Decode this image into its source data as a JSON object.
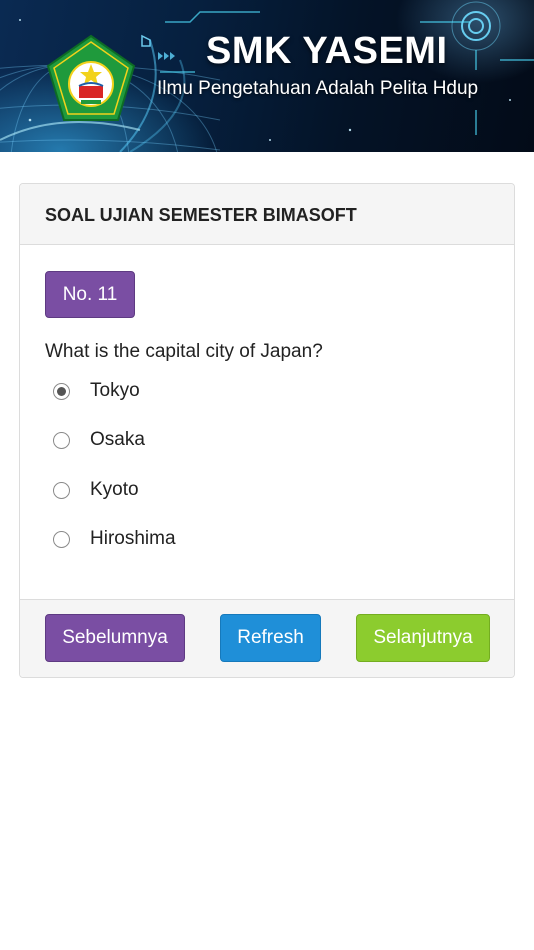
{
  "header": {
    "school_name": "SMK YASEMI",
    "motto": "Ilmu Pengetahuan Adalah Pelita Hdup"
  },
  "panel": {
    "title": "SOAL UJIAN SEMESTER BIMASOFT",
    "question_number": "No. 11",
    "question": "What is the capital city of Japan?",
    "options": [
      {
        "label": "Tokyo",
        "selected": true
      },
      {
        "label": "Osaka",
        "selected": false
      },
      {
        "label": "Kyoto",
        "selected": false
      },
      {
        "label": "Hiroshima",
        "selected": false
      }
    ]
  },
  "footer": {
    "prev_label": "Sebelumnya",
    "refresh_label": "Refresh",
    "next_label": "Selanjutnya"
  },
  "colors": {
    "purple": "#7a4ea3",
    "blue": "#1f8fd8",
    "green": "#8ccc2e"
  }
}
